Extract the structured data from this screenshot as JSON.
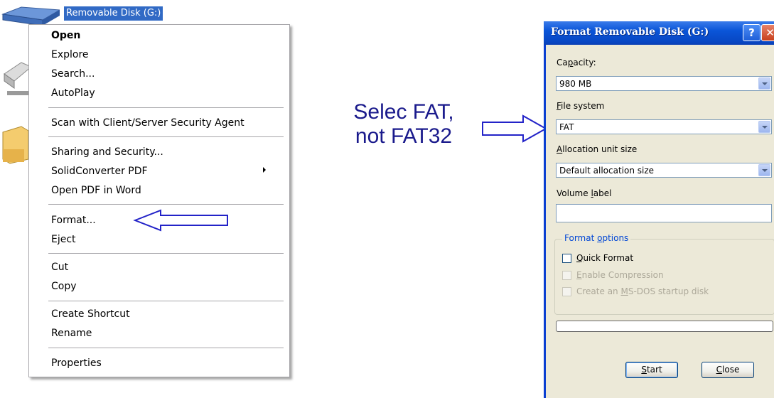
{
  "desktop": {
    "drive_label": "Removable Disk (G:)"
  },
  "context_menu": {
    "items": [
      {
        "label": "Open"
      },
      {
        "label": "Explore"
      },
      {
        "label": "Search..."
      },
      {
        "label": "AutoPlay"
      },
      {
        "label": "Scan with Client/Server Security Agent"
      },
      {
        "label": "Sharing and Security..."
      },
      {
        "label": "SolidConverter PDF"
      },
      {
        "label": "Open PDF in Word"
      },
      {
        "label": "Format..."
      },
      {
        "label": "Eject"
      },
      {
        "label": "Cut"
      },
      {
        "label": "Copy"
      },
      {
        "label": "Create Shortcut"
      },
      {
        "label": "Rename"
      },
      {
        "label": "Properties"
      }
    ]
  },
  "annotation": {
    "line1": "Selec FAT,",
    "line2": "not FAT32"
  },
  "dialog": {
    "title": "Format Removable Disk (G:)",
    "help_glyph": "?",
    "close_glyph": "✕",
    "capacity": {
      "label_pre": "Ca",
      "label_key": "p",
      "label_post": "acity:",
      "value": "980 MB"
    },
    "file_system": {
      "label_key": "F",
      "label_post": "ile system",
      "value": "FAT"
    },
    "allocation": {
      "label_key": "A",
      "label_post": "llocation unit size",
      "value": "Default allocation size"
    },
    "volume": {
      "label_pre": "Volume ",
      "label_key": "l",
      "label_post": "abel",
      "value": ""
    },
    "format_options": {
      "title_pre": "Format ",
      "title_key": "o",
      "title_post": "ptions",
      "quick": {
        "key": "Q",
        "post": "uick Format"
      },
      "compression": {
        "key": "E",
        "post": "nable Compression"
      },
      "msdos": {
        "pre": "Create an ",
        "key": "M",
        "post": "S-DOS startup disk"
      }
    },
    "start": {
      "key": "S",
      "post": "tart"
    },
    "close": {
      "key": "C",
      "post": "lose"
    }
  },
  "colors": {
    "titlebar": "#0a55d8",
    "selection": "#316ac5",
    "annotation": "#1a1a8c",
    "dialog_bg": "#ece9d8"
  }
}
